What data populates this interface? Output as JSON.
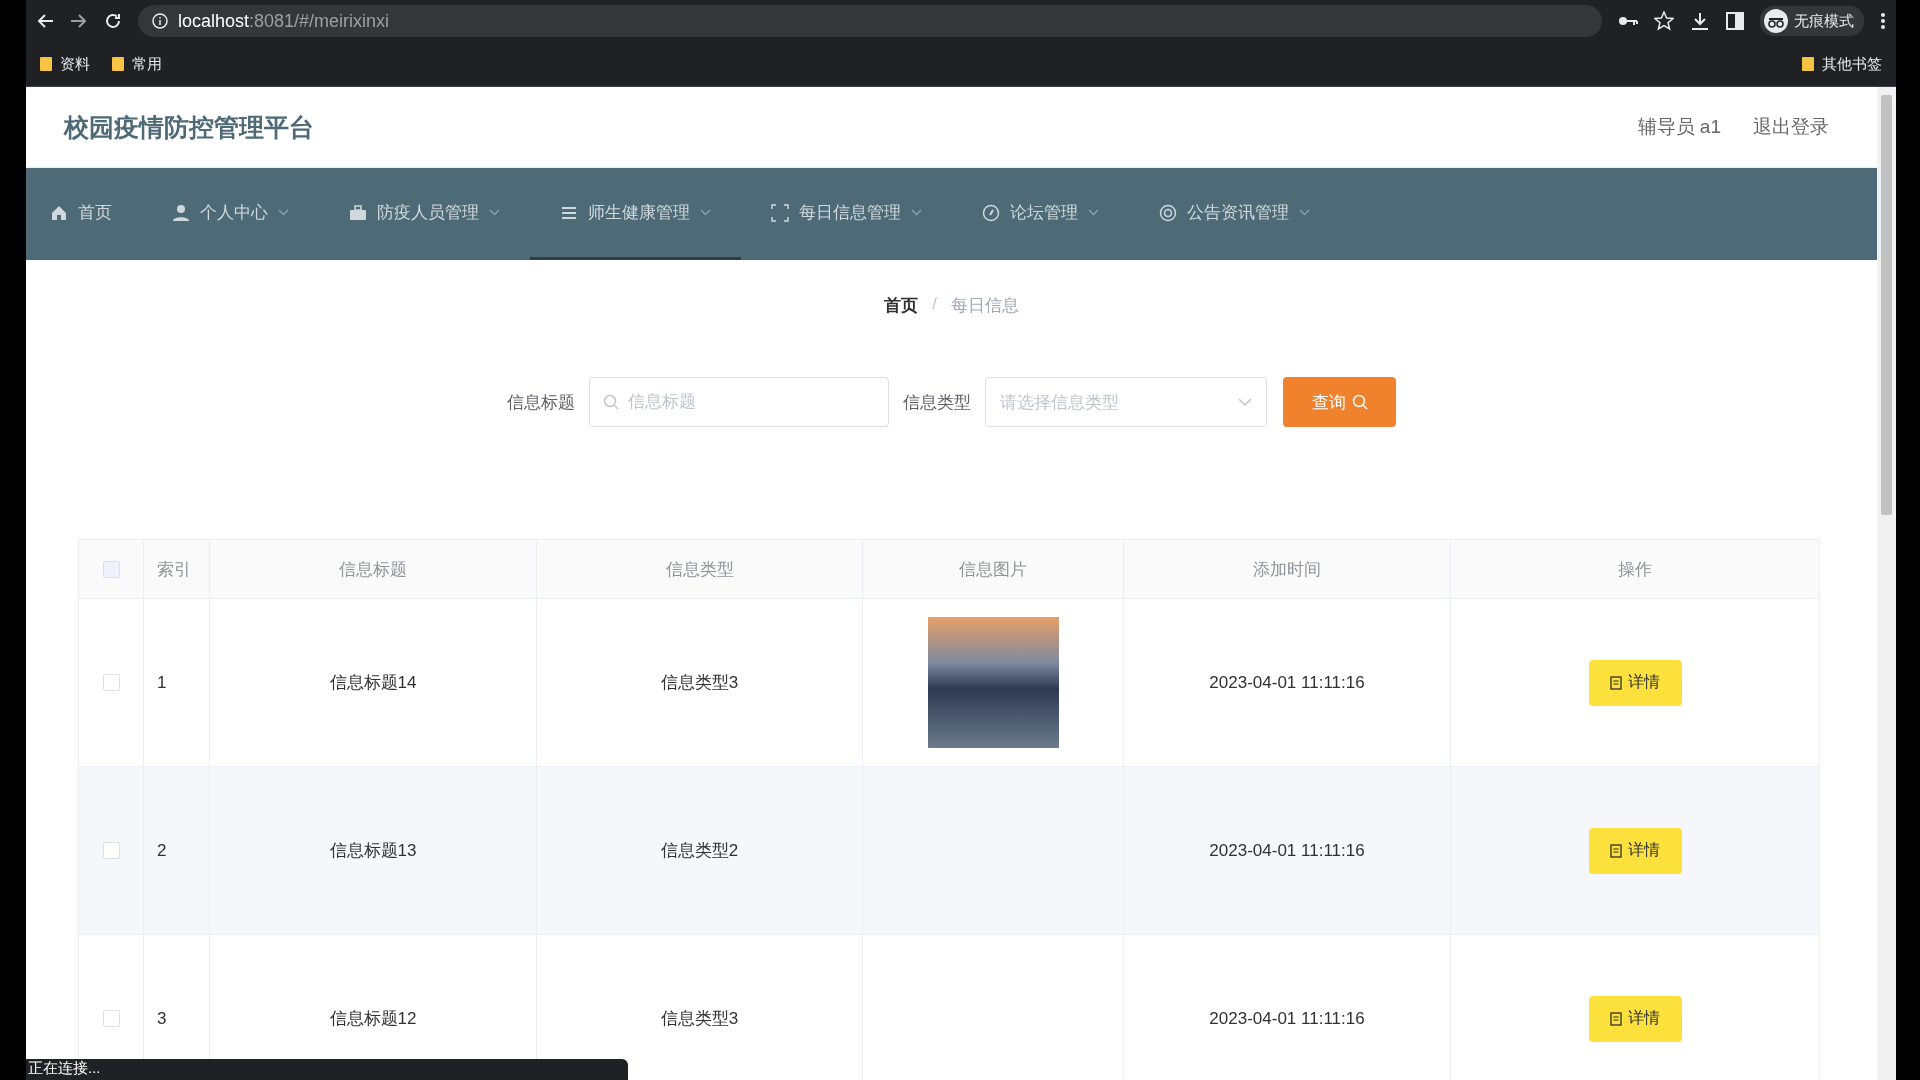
{
  "browser": {
    "url_host": "localhost",
    "url_rest": ":8081/#/meirixinxi",
    "profile": "无痕模式",
    "bookmarks": [
      "资料",
      "常用"
    ],
    "other_bookmarks": "其他书签",
    "status": "正在连接..."
  },
  "app": {
    "title": "校园疫情防控管理平台",
    "user": "辅导员 a1",
    "logout": "退出登录"
  },
  "nav": [
    {
      "label": "首页",
      "dropdown": false,
      "selected": false
    },
    {
      "label": "个人中心",
      "dropdown": true,
      "selected": false
    },
    {
      "label": "防疫人员管理",
      "dropdown": true,
      "selected": false
    },
    {
      "label": "师生健康管理",
      "dropdown": true,
      "selected": true
    },
    {
      "label": "每日信息管理",
      "dropdown": true,
      "selected": false
    },
    {
      "label": "论坛管理",
      "dropdown": true,
      "selected": false
    },
    {
      "label": "公告资讯管理",
      "dropdown": true,
      "selected": false
    }
  ],
  "breadcrumb": [
    "首页",
    "每日信息"
  ],
  "breadcrumb_separator": "/",
  "search": {
    "title_label": "信息标题",
    "title_placeholder": "信息标题",
    "type_label": "信息类型",
    "type_placeholder": "请选择信息类型",
    "button": "查询"
  },
  "table": {
    "all_checked": false,
    "columns": [
      "索引",
      "信息标题",
      "信息类型",
      "信息图片",
      "添加时间",
      "操作"
    ],
    "rows": [
      {
        "index": "1",
        "title": "信息标题14",
        "type": "信息类型3",
        "has_image": true,
        "time": "2023-04-01 11:11:16",
        "action": "详情",
        "checked": false
      },
      {
        "index": "2",
        "title": "信息标题13",
        "type": "信息类型2",
        "has_image": false,
        "time": "2023-04-01 11:11:16",
        "action": "详情",
        "checked": false
      },
      {
        "index": "3",
        "title": "信息标题12",
        "type": "信息类型3",
        "has_image": false,
        "time": "2023-04-01 11:11:16",
        "action": "详情",
        "checked": false
      }
    ]
  }
}
